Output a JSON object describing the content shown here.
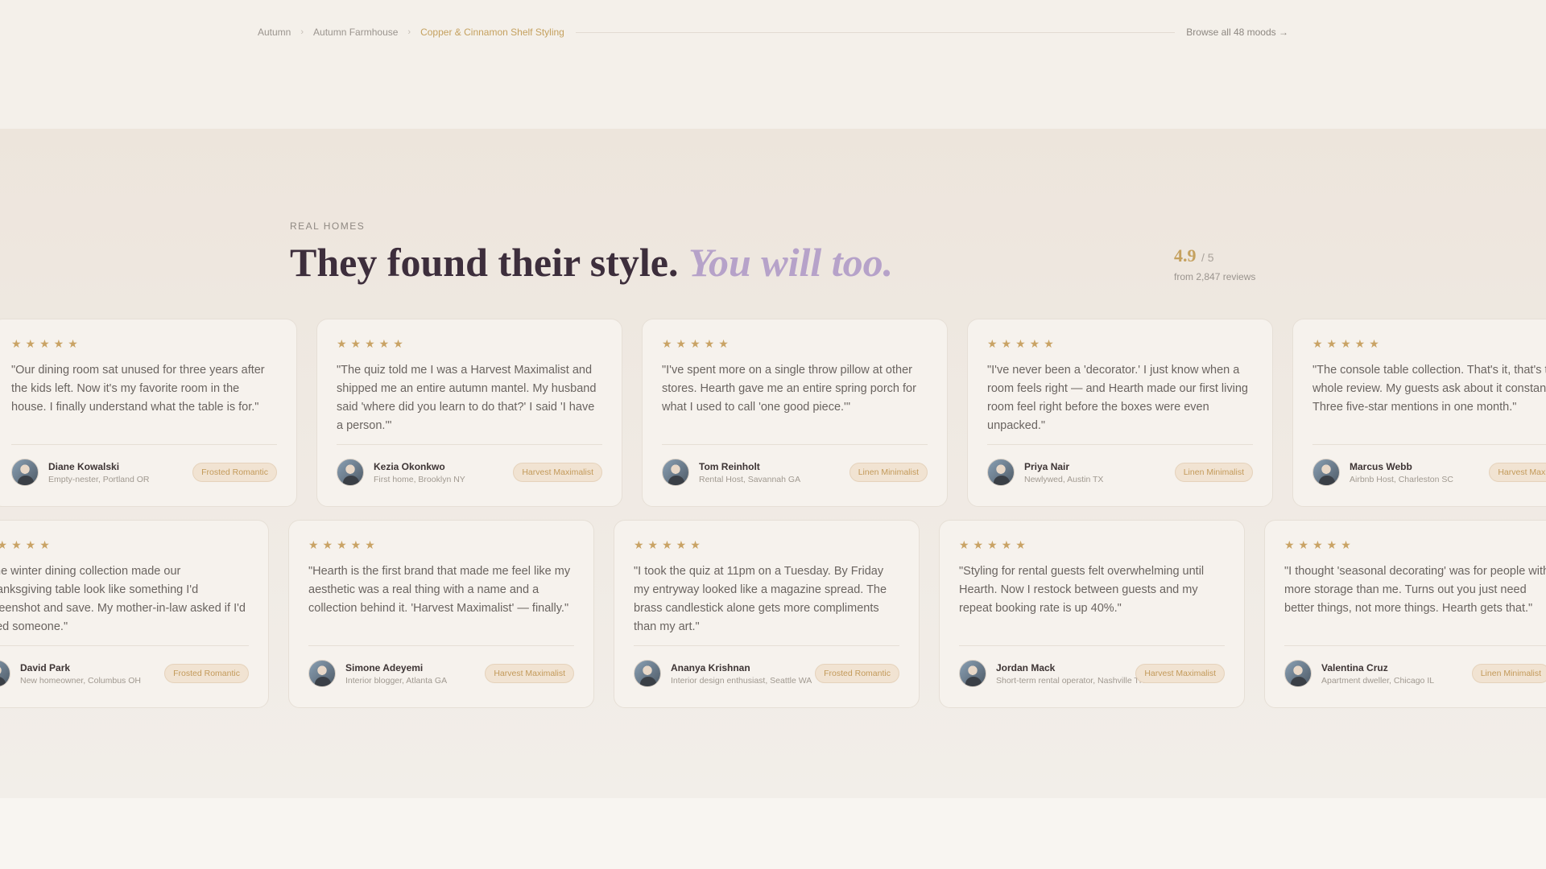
{
  "breadcrumb": {
    "items": [
      "Autumn",
      "Autumn Farmhouse",
      "Copper & Cinnamon Shelf Styling"
    ],
    "right_link": "Browse all 48 moods →"
  },
  "section": {
    "eyebrow": "REAL HOMES",
    "heading_main": "They found their style.",
    "heading_accent": "You will too.",
    "rating_score": "4.9",
    "rating_out": "/ 5",
    "rating_sub": "from 2,847 reviews"
  },
  "row1": [
    {
      "stars": "★★★★★",
      "quote": "\"Our dining room sat unused for three years after the kids left. Now it's my favorite room in the house. I finally understand what the table is for.\"",
      "name": "Diane Kowalski",
      "role": "Empty-nester, Portland OR",
      "tag": "Frosted Romantic"
    },
    {
      "stars": "★★★★★",
      "quote": "\"The quiz told me I was a Harvest Maximalist and shipped me an entire autumn mantel. My husband said 'where did you learn to do that?' I said 'I have a person.'\"",
      "name": "Kezia Okonkwo",
      "role": "First home, Brooklyn NY",
      "tag": "Harvest Maximalist"
    },
    {
      "stars": "★★★★★",
      "quote": "\"I've spent more on a single throw pillow at other stores. Hearth gave me an entire spring porch for what I used to call 'one good piece.'\"",
      "name": "Tom Reinholt",
      "role": "Rental Host, Savannah GA",
      "tag": "Linen Minimalist"
    },
    {
      "stars": "★★★★★",
      "quote": "\"I've never been a 'decorator.' I just know when a room feels right — and Hearth made our first living room feel right before the boxes were even unpacked.\"",
      "name": "Priya Nair",
      "role": "Newlywed, Austin TX",
      "tag": "Linen Minimalist"
    },
    {
      "stars": "★★★★★",
      "quote": "\"The console table collection. That's it, that's the whole review. My guests ask about it constantly. Three five-star mentions in one month.\"",
      "name": "Marcus Webb",
      "role": "Airbnb Host, Charleston SC",
      "tag": "Harvest Maximalist"
    }
  ],
  "row2": [
    {
      "stars": "★★★★★",
      "quote": "\"The winter dining collection made our Thanksgiving table look like something I'd screenshot and save. My mother-in-law asked if I'd hired someone.\"",
      "name": "David Park",
      "role": "New homeowner, Columbus OH",
      "tag": "Frosted Romantic"
    },
    {
      "stars": "★★★★★",
      "quote": "\"Hearth is the first brand that made me feel like my aesthetic was a real thing with a name and a collection behind it. 'Harvest Maximalist' — finally.\"",
      "name": "Simone Adeyemi",
      "role": "Interior blogger, Atlanta GA",
      "tag": "Harvest Maximalist"
    },
    {
      "stars": "★★★★★",
      "quote": "\"I took the quiz at 11pm on a Tuesday. By Friday my entryway looked like a magazine spread. The brass candlestick alone gets more compliments than my art.\"",
      "name": "Ananya Krishnan",
      "role": "Interior design enthusiast, Seattle WA",
      "tag": "Frosted Romantic"
    },
    {
      "stars": "★★★★★",
      "quote": "\"Styling for rental guests felt overwhelming until Hearth. Now I restock between guests and my repeat booking rate is up 40%.\"",
      "name": "Jordan Mack",
      "role": "Short-term rental operator, Nashville TN",
      "tag": "Harvest Maximalist"
    },
    {
      "stars": "★★★★★",
      "quote": "\"I thought 'seasonal decorating' was for people with more storage than me. Turns out you just need better things, not more things. Hearth gets that.\"",
      "name": "Valentina Cruz",
      "role": "Apartment dweller, Chicago IL",
      "tag": "Linen Minimalist"
    }
  ]
}
